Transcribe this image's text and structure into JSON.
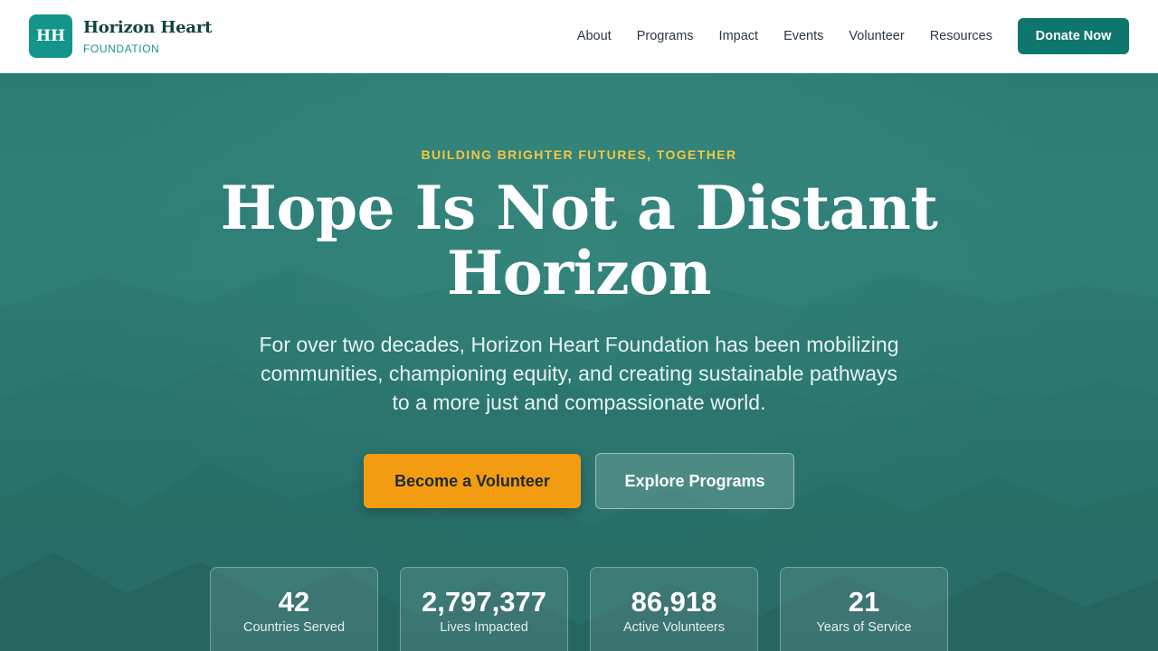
{
  "brand": {
    "mark": "HH",
    "name": "Horizon Heart",
    "sub": "FOUNDATION"
  },
  "nav": {
    "items": [
      {
        "label": "About"
      },
      {
        "label": "Programs"
      },
      {
        "label": "Impact"
      },
      {
        "label": "Events"
      },
      {
        "label": "Volunteer"
      },
      {
        "label": "Resources"
      }
    ],
    "cta": "Donate Now"
  },
  "hero": {
    "eyebrow": "BUILDING BRIGHTER FUTURES, TOGETHER",
    "headline": "Hope Is Not a Distant Horizon",
    "lede": "For over two decades, Horizon Heart Foundation has been mobilizing communities, championing equity, and creating sustainable pathways to a more just and compassionate world.",
    "primary_cta": "Become a Volunteer",
    "secondary_cta": "Explore Programs"
  },
  "stats": [
    {
      "value": "42",
      "label": "Countries Served"
    },
    {
      "value": "2,797,377",
      "label": "Lives Impacted"
    },
    {
      "value": "86,918",
      "label": "Active Volunteers"
    },
    {
      "value": "21",
      "label": "Years of Service"
    }
  ],
  "colors": {
    "accent": "#14948a",
    "donate": "#0f766e",
    "eyebrow": "#f4c542",
    "primary_button": "#f39c12"
  }
}
